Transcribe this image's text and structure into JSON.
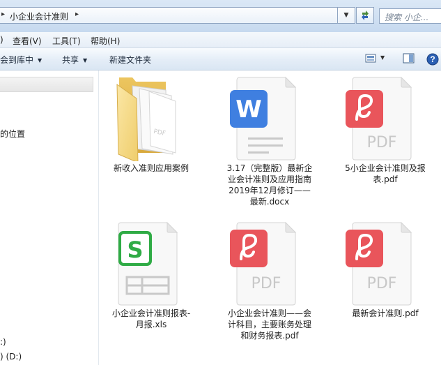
{
  "address": {
    "path": "小企业会计准则",
    "search_placeholder": "搜索 小企..."
  },
  "menu": [
    "查看(V)",
    "工具(T)",
    "帮助(H)"
  ],
  "menu_partial_first": ")",
  "commands": {
    "include_library": "会到库中",
    "share": "共享",
    "new_folder": "新建文件夹"
  },
  "nav": {
    "recent_places": "的位置",
    "drive_c": ":)",
    "drive_d": ") (D:)"
  },
  "files": [
    {
      "name": "新收入准则应用案例",
      "type": "folder"
    },
    {
      "name": "3.17（完整版）最新企业会计准则及应用指南2019年12月修订——最新.docx",
      "type": "docx",
      "lines": [
        "3.17（完整版）最新企",
        "业会计准则及应用指南",
        "2019年12月修订——",
        "最新.docx"
      ]
    },
    {
      "name": "5小企业会计准则及报表.pdf",
      "type": "pdf",
      "lines": [
        "5小企业会计准则及报",
        "表.pdf"
      ]
    },
    {
      "name": "小企业会计准则报表-月报.xls",
      "type": "xls",
      "lines": [
        "小企业会计准则报表-",
        "月报.xls"
      ]
    },
    {
      "name": "小企业会计准则——会计科目，主要账务处理和财务报表.pdf",
      "type": "pdf",
      "lines": [
        "小企业会计准则——会",
        "计科目，主要账务处理",
        "和财务报表.pdf"
      ]
    },
    {
      "name": "最新会计准则.pdf",
      "type": "pdf",
      "lines": [
        "最新会计准则.pdf"
      ]
    }
  ],
  "icons": {
    "word_letter": "W",
    "excel_letter": "S",
    "pdf_label": "PDF",
    "folder_overlay": "PDF"
  },
  "colors": {
    "word": "#3f7fe0",
    "excel": "#2fab45",
    "pdf": "#e9555b",
    "folder": "#f3d37c"
  }
}
